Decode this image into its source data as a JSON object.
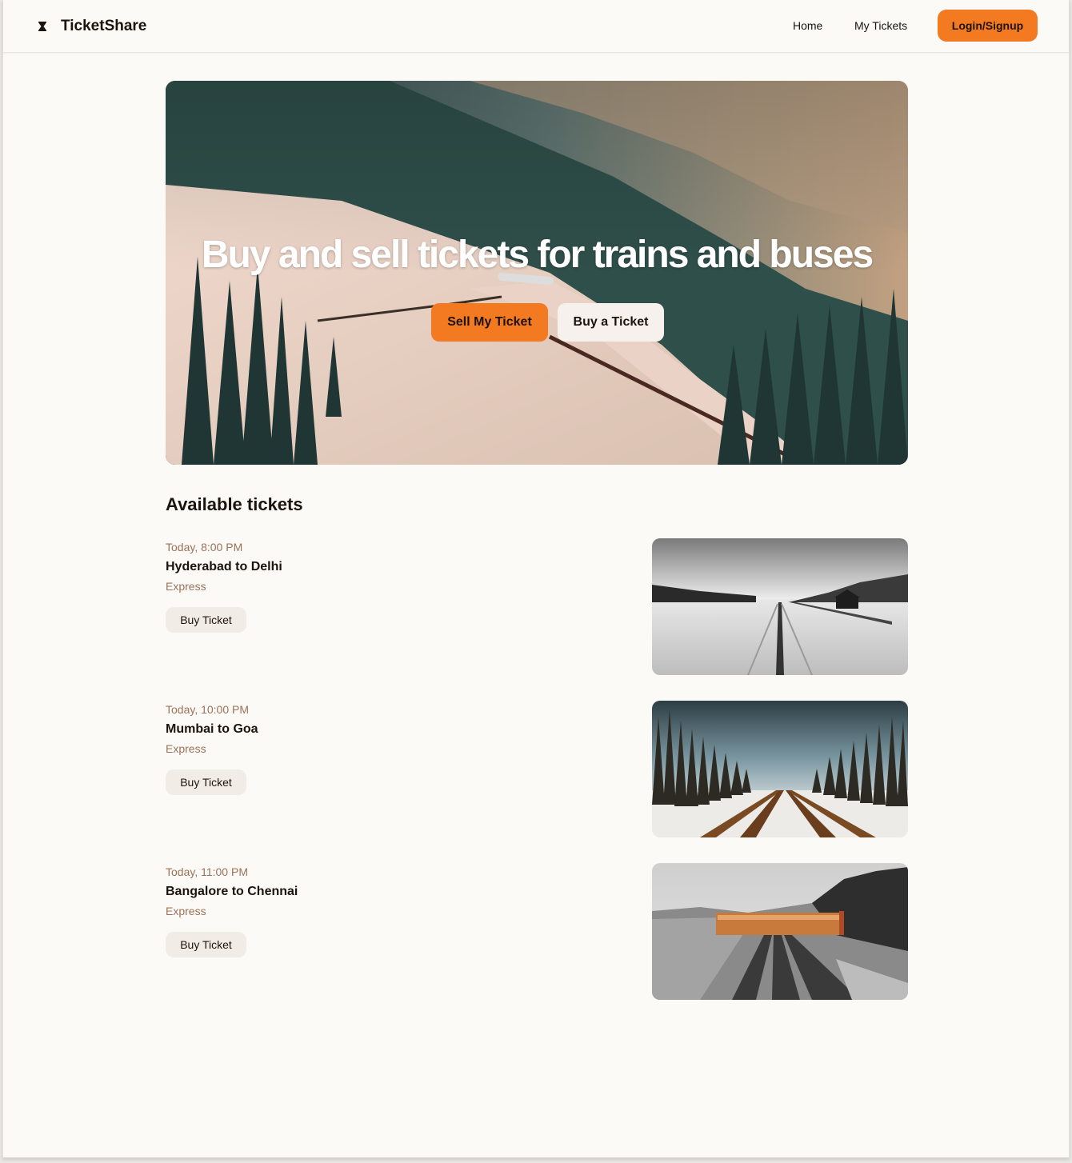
{
  "app": {
    "name": "TicketShare",
    "logo_icon": "hourglass-logo-icon"
  },
  "nav": {
    "home_label": "Home",
    "my_tickets_label": "My Tickets",
    "login_label": "Login/Signup"
  },
  "hero": {
    "title": "Buy and sell tickets for trains and buses",
    "sell_label": "Sell My Ticket",
    "buy_label": "Buy a Ticket"
  },
  "tickets_section": {
    "title": "Available tickets",
    "items": [
      {
        "time": "Today, 8:00 PM",
        "route": "Hyderabad to Delhi",
        "type": "Express",
        "button": "Buy Ticket"
      },
      {
        "time": "Today, 10:00 PM",
        "route": "Mumbai to Goa",
        "type": "Express",
        "button": "Buy Ticket"
      },
      {
        "time": "Today, 11:00 PM",
        "route": "Bangalore to Chennai",
        "type": "Express",
        "button": "Buy Ticket"
      }
    ]
  },
  "colors": {
    "accent": "#f47a22",
    "page_background": "#fbfaf7",
    "text": "#1c130d",
    "muted_text": "#9c7258",
    "secondary_button": "#f2ece7"
  }
}
